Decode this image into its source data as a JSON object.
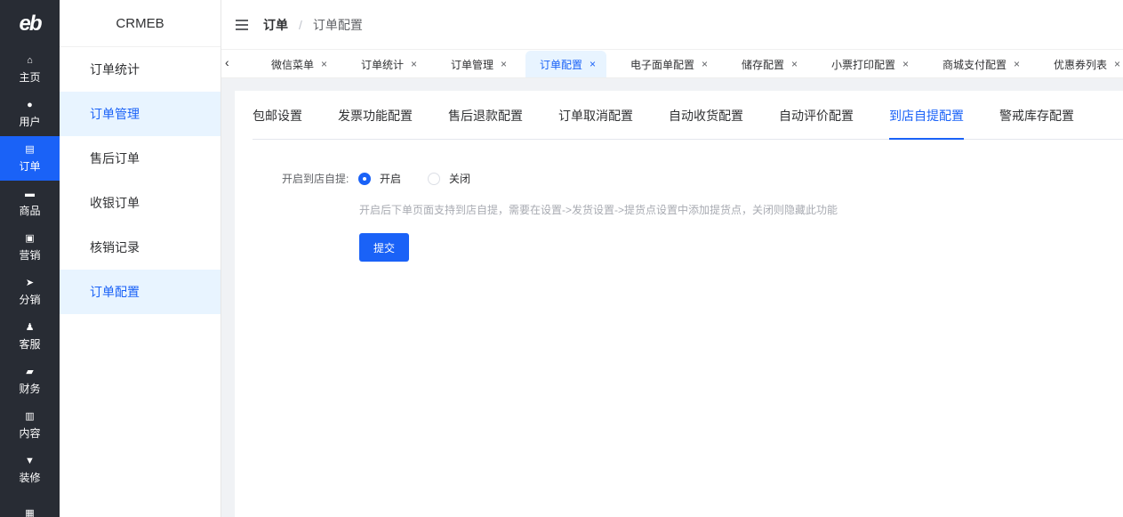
{
  "rail": {
    "logo": "eb",
    "items": [
      {
        "label": "主页",
        "icon": "home-icon",
        "glyph": "⌂"
      },
      {
        "label": "用户",
        "icon": "user-icon",
        "glyph": "●"
      },
      {
        "label": "订单",
        "icon": "order-icon",
        "glyph": "▤"
      },
      {
        "label": "商品",
        "icon": "goods-icon",
        "glyph": "▬"
      },
      {
        "label": "营销",
        "icon": "chart-icon",
        "glyph": "▣"
      },
      {
        "label": "分销",
        "icon": "send-icon",
        "glyph": "➤"
      },
      {
        "label": "客服",
        "icon": "bell-icon",
        "glyph": "♟"
      },
      {
        "label": "财务",
        "icon": "wallet-icon",
        "glyph": "▰"
      },
      {
        "label": "内容",
        "icon": "content-icon",
        "glyph": "▥"
      },
      {
        "label": "装修",
        "icon": "brush-icon",
        "glyph": "▼"
      },
      {
        "label": "",
        "icon": "grid-icon",
        "glyph": "▦"
      }
    ]
  },
  "submenu": {
    "brand": "CRMEB",
    "items": [
      "订单统计",
      "订单管理",
      "售后订单",
      "收银订单",
      "核销记录",
      "订单配置"
    ]
  },
  "header": {
    "crumb_parent": "订单",
    "crumb_sep": "/",
    "crumb_current": "订单配置"
  },
  "tabs": [
    {
      "label": "微信菜单",
      "close": "×"
    },
    {
      "label": "订单统计",
      "close": "×"
    },
    {
      "label": "订单管理",
      "close": "×"
    },
    {
      "label": "订单配置",
      "close": "×"
    },
    {
      "label": "电子面单配置",
      "close": "×"
    },
    {
      "label": "储存配置",
      "close": "×"
    },
    {
      "label": "小票打印配置",
      "close": "×"
    },
    {
      "label": "商城支付配置",
      "close": "×"
    },
    {
      "label": "优惠券列表",
      "close": "×"
    }
  ],
  "config_tabs": [
    "包邮设置",
    "发票功能配置",
    "售后退款配置",
    "订单取消配置",
    "自动收货配置",
    "自动评价配置",
    "到店自提配置",
    "警戒库存配置"
  ],
  "form": {
    "label": "开启到店自提:",
    "option_on": "开启",
    "option_off": "关闭",
    "selected": "开启",
    "hint": "开启后下单页面支持到店自提，需要在设置->发货设置->提货点设置中添加提货点，关闭则隐藏此功能",
    "submit": "提交"
  },
  "colors": {
    "accent": "#1a62f7",
    "rail_bg": "#282c34",
    "active_bg": "#e8f4ff"
  }
}
